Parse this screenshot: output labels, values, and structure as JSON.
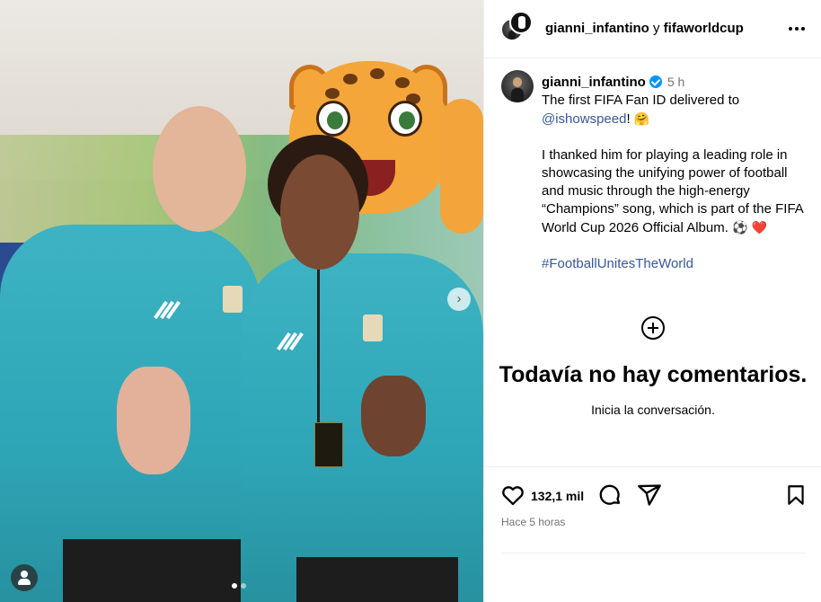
{
  "header": {
    "user1": "gianni_infantino",
    "connector": "y",
    "user2": "fifaworldcup",
    "more_icon": "more-horizontal-icon"
  },
  "caption": {
    "username": "gianni_infantino",
    "verified": true,
    "time": "5 h",
    "line1": "The first FIFA Fan ID delivered to",
    "mention": "@ishowspeed",
    "mention_suffix": "!",
    "emoji1": "🤗",
    "body": "I thanked him for playing a leading role in showcasing the unifying power of football and music through the high-energy “Champions” song, which is part of the FIFA World Cup 2026 Official Album.",
    "emoji2": "⚽",
    "emoji3": "❤️",
    "hashtag": "#FootballUnitesTheWorld"
  },
  "comments": {
    "empty_title": "Todavía no hay comentarios.",
    "empty_subtitle": "Inicia la conversación."
  },
  "actions": {
    "likes": "132,1 mil",
    "posted": "Hace 5 horas",
    "icons": [
      "heart-icon",
      "comment-icon",
      "share-icon",
      "bookmark-icon"
    ]
  },
  "carousel": {
    "current": 1,
    "total": 2
  }
}
